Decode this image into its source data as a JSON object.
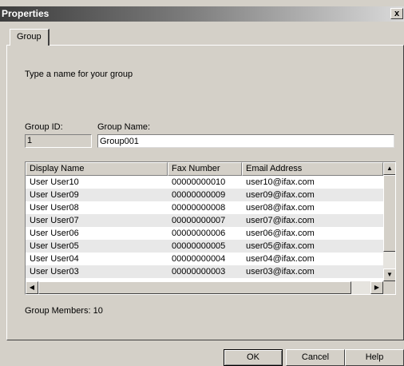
{
  "window": {
    "title": "Properties",
    "close_glyph": "x"
  },
  "tabs": [
    {
      "label": "Group"
    }
  ],
  "instruction": "Type a name for your group",
  "group_id": {
    "label": "Group ID:",
    "value": "1"
  },
  "group_name": {
    "label": "Group Name:",
    "value": "Group001"
  },
  "table": {
    "columns": [
      "Display Name",
      "Fax Number",
      "Email Address"
    ],
    "rows": [
      {
        "name": "User User10",
        "fax": "00000000010",
        "email": "user10@ifax.com"
      },
      {
        "name": "User User09",
        "fax": "00000000009",
        "email": "user09@ifax.com"
      },
      {
        "name": "User User08",
        "fax": "00000000008",
        "email": "user08@ifax.com"
      },
      {
        "name": "User User07",
        "fax": "00000000007",
        "email": "user07@ifax.com"
      },
      {
        "name": "User User06",
        "fax": "00000000006",
        "email": "user06@ifax.com"
      },
      {
        "name": "User User05",
        "fax": "00000000005",
        "email": "user05@ifax.com"
      },
      {
        "name": "User User04",
        "fax": "00000000004",
        "email": "user04@ifax.com"
      },
      {
        "name": "User User03",
        "fax": "00000000003",
        "email": "user03@ifax.com"
      }
    ]
  },
  "scroll_icons": {
    "up": "▲",
    "down": "▼",
    "left": "◀",
    "right": "▶"
  },
  "members": "Group Members: 10",
  "buttons": {
    "ok": "OK",
    "cancel": "Cancel",
    "help": "Help"
  }
}
